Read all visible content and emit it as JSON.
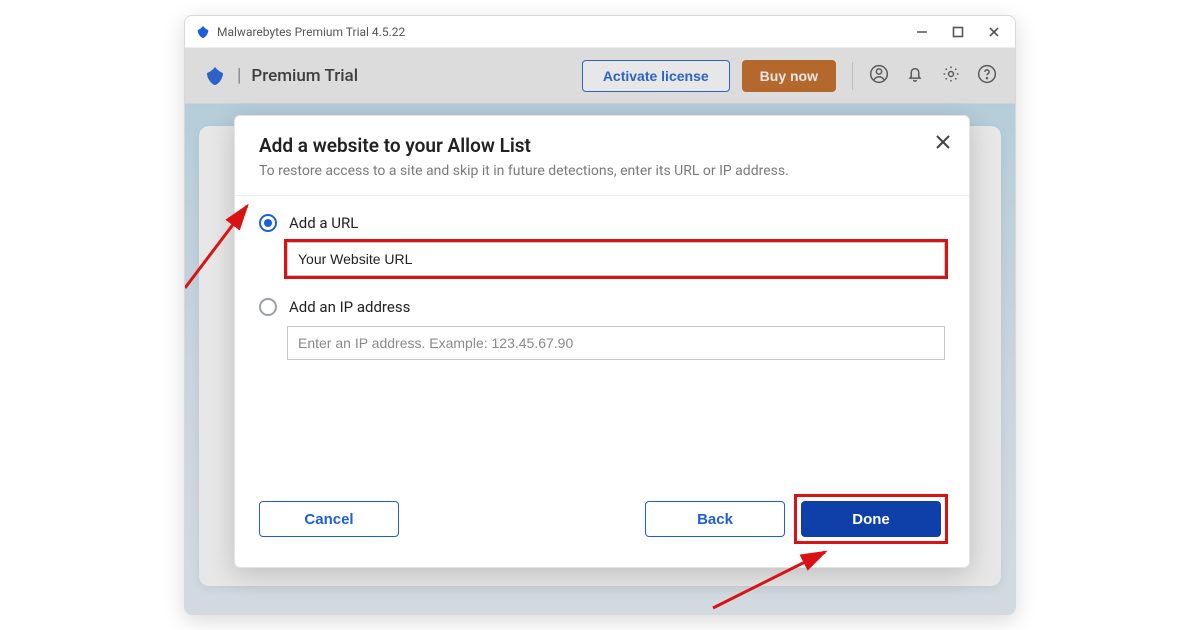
{
  "titlebar": {
    "text": "Malwarebytes Premium Trial  4.5.22"
  },
  "header": {
    "brand": "Premium Trial",
    "activate": "Activate license",
    "buynow": "Buy now"
  },
  "modal": {
    "title": "Add a website to your Allow List",
    "subtitle": "To restore access to a site and skip it in future detections, enter its URL or IP address.",
    "option_url_label": "Add a URL",
    "url_value": "Your Website URL",
    "option_ip_label": "Add an IP address",
    "ip_placeholder": "Enter an IP address. Example: 123.45.67.90",
    "cancel": "Cancel",
    "back": "Back",
    "done": "Done"
  }
}
